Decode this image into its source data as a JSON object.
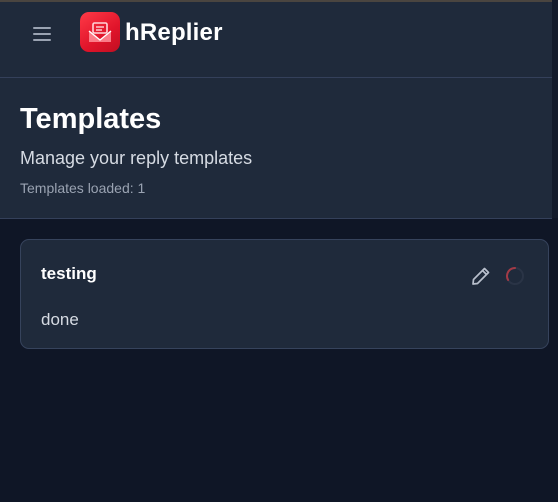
{
  "app": {
    "name": "hReplier",
    "accent_color": "#e0142a",
    "menu_icon": "hamburger-menu-icon",
    "logo_icon": "hreplier-logo-icon"
  },
  "page": {
    "title": "Templates",
    "subtitle": "Manage your reply templates",
    "status": "Templates loaded: 1"
  },
  "templates": [
    {
      "title": "testing",
      "body": "done",
      "actions": {
        "edit_icon": "pencil-icon",
        "loading_icon": "loading-spinner-icon"
      }
    }
  ]
}
